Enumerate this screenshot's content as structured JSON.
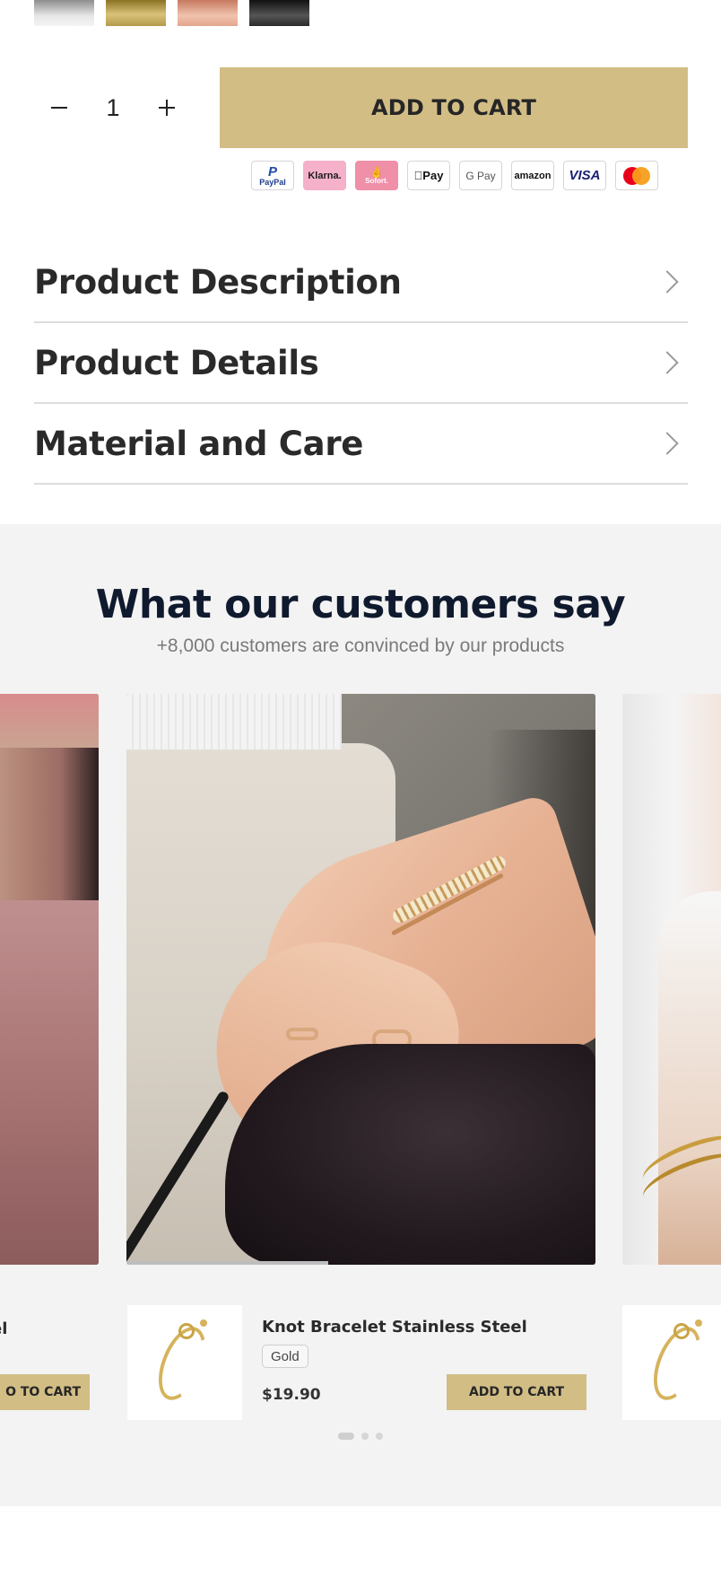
{
  "swatches": [
    {
      "name": "silver",
      "color": "#d9d9d9"
    },
    {
      "name": "gold",
      "color": "#c9ad5c"
    },
    {
      "name": "rose-gold",
      "color": "#e4a68e"
    },
    {
      "name": "black",
      "color": "#333333"
    }
  ],
  "purchase": {
    "quantity": "1",
    "decrement_icon": "minus-icon",
    "increment_icon": "plus-icon",
    "add_to_cart_label": "ADD TO CART"
  },
  "payments": {
    "paypal": "PayPal",
    "klarna": "Klarna.",
    "sofort": "Sofort.",
    "applepay": "Pay",
    "gpay": "G Pay",
    "amazon": "amazon",
    "visa": "VISA",
    "mastercard": "mastercard-icon"
  },
  "accordion": [
    {
      "title": "Product Description"
    },
    {
      "title": "Product Details"
    },
    {
      "title": "Material and Care"
    }
  ],
  "reviews": {
    "title": "What our customers say",
    "subtitle": "+8,000 customers are convinced by our products",
    "active_slide_progress": 0.43
  },
  "products": {
    "left": {
      "title_fragment": "el",
      "button_fragment": "O TO CART"
    },
    "main": {
      "title": "Knot Bracelet Stainless Steel",
      "variant": "Gold",
      "price": "$19.90",
      "button": "ADD TO CART"
    }
  },
  "colors": {
    "accent": "#d2bd85",
    "section_bg": "#f3f3f3",
    "heading": "#101a2e"
  }
}
